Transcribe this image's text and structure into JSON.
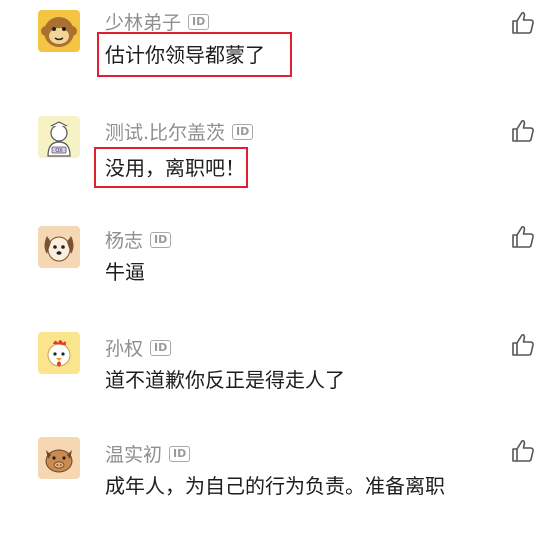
{
  "comments": [
    {
      "username": "少林弟子",
      "id_badge": "ID",
      "text": "估计你领导都蒙了",
      "avatar": "monkey-avatar",
      "highlighted": true
    },
    {
      "username": "测试.比尔盖茨",
      "id_badge": "ID",
      "text": "没用，离职吧！",
      "avatar": "ox-chef-avatar",
      "highlighted": true
    },
    {
      "username": "杨志",
      "id_badge": "ID",
      "text": "牛逼",
      "avatar": "dog-avatar",
      "highlighted": false
    },
    {
      "username": "孙权",
      "id_badge": "ID",
      "text": "道不道歉你反正是得走人了",
      "avatar": "rooster-avatar",
      "highlighted": false
    },
    {
      "username": "温实初",
      "id_badge": "ID",
      "text": "成年人，为自己的行为负责。准备离职",
      "avatar": "pig-avatar",
      "highlighted": false
    }
  ],
  "colors": {
    "highlight": "#e0202e",
    "username": "#8f8f8f",
    "text": "#1d1d1d"
  }
}
